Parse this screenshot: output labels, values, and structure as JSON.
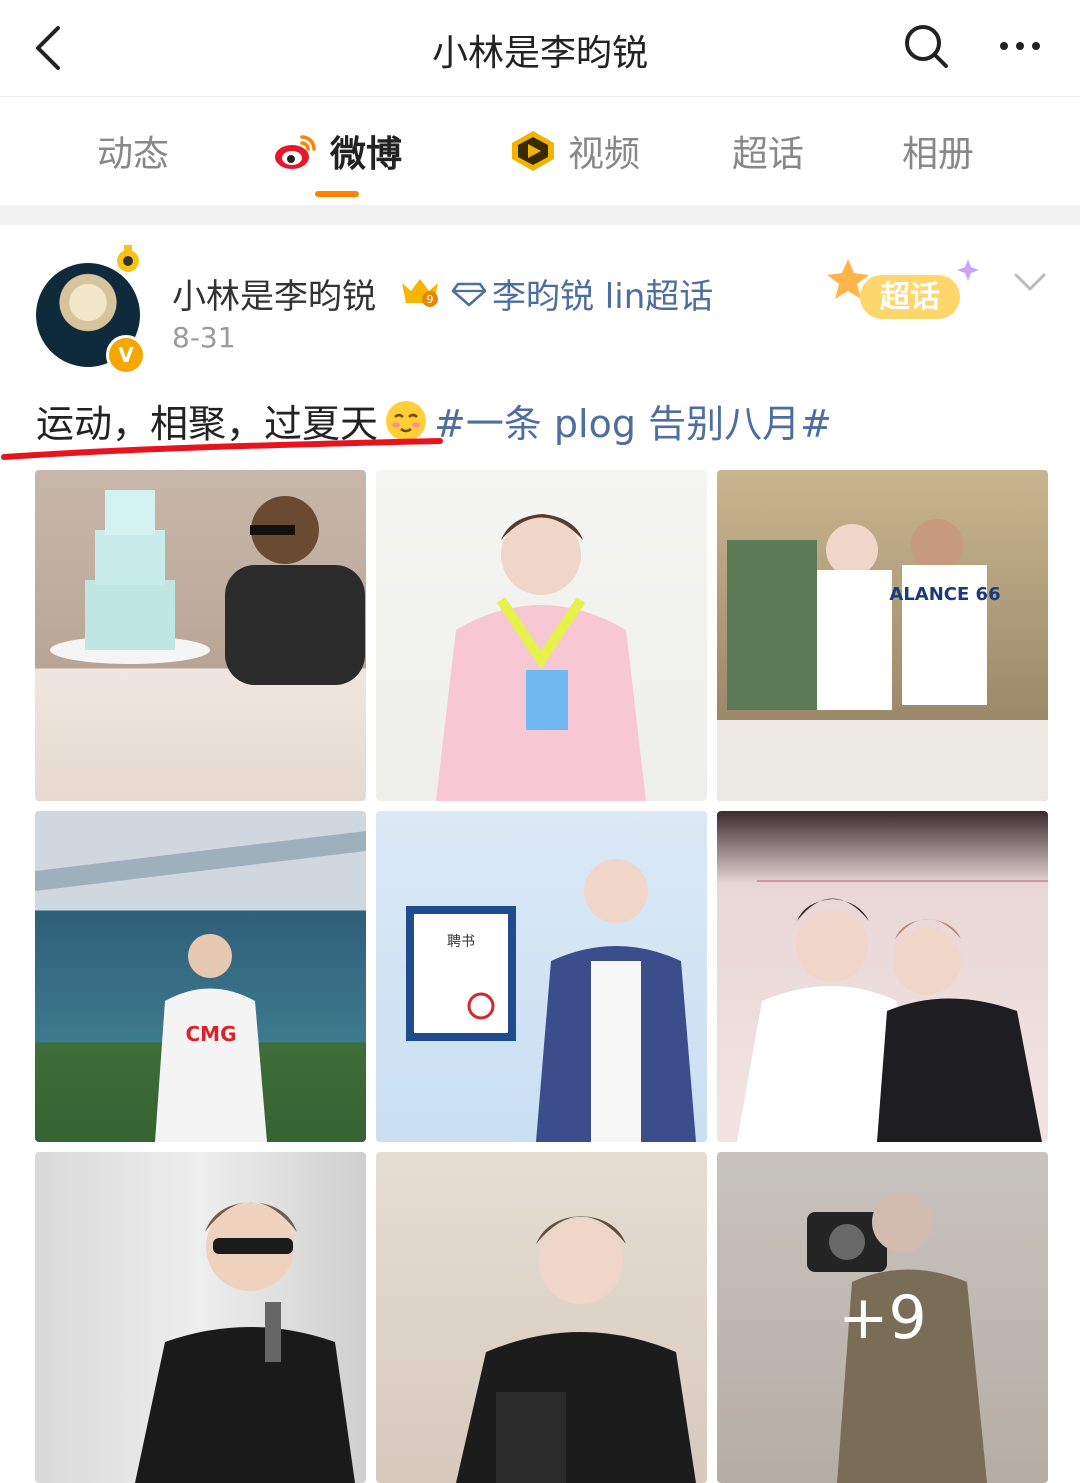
{
  "header": {
    "title": "小林是李昀锐"
  },
  "tabs": [
    {
      "label": "动态",
      "active": false
    },
    {
      "label": "微博",
      "active": true
    },
    {
      "label": "视频",
      "active": false
    },
    {
      "label": "超话",
      "active": false
    },
    {
      "label": "相册",
      "active": false
    }
  ],
  "post": {
    "author": "小林是李昀锐",
    "supertopic": "李昀锐 lin超话",
    "date": "8-31",
    "badge": "超话",
    "verified_mark": "V",
    "text": "运动，相聚，过夏天",
    "hashtag": "#一条 plog 告别八月#",
    "more_photos": "+9",
    "photo_captions": {
      "stadium_tshirt": "CMG",
      "jersey": "ALANCE 66",
      "certificate": "聘书"
    }
  },
  "colors": {
    "accent": "#ff8200",
    "link": "#4e6ea0",
    "underline_mark": "#e8131d",
    "verified": "#f7a600"
  },
  "icons": [
    "back-icon",
    "search-icon",
    "more-icon",
    "weibo-icon",
    "video-icon",
    "crown-icon",
    "diamond-icon",
    "chevron-down-icon",
    "emoji-icon"
  ]
}
